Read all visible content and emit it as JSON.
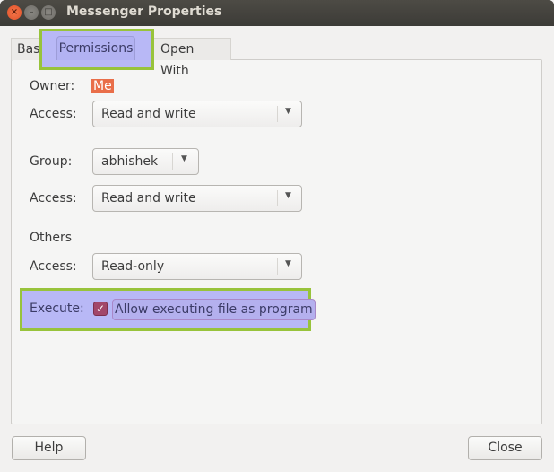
{
  "window": {
    "title": "Messenger Properties",
    "controls": {
      "close": "×",
      "minimize": "–",
      "maximize": "□"
    }
  },
  "tabs": [
    {
      "label": "Basic",
      "active": false
    },
    {
      "label": "Permissions",
      "active": true
    },
    {
      "label": "Open With",
      "active": false
    }
  ],
  "permissions": {
    "owner_label": "Owner:",
    "owner_value": "Me",
    "owner_access_label": "Access:",
    "owner_access_value": "Read and write",
    "group_label": "Group:",
    "group_value": "abhishek",
    "group_access_label": "Access:",
    "group_access_value": "Read and write",
    "others_label": "Others",
    "others_access_label": "Access:",
    "others_access_value": "Read-only",
    "execute_label": "Execute:",
    "execute_checkbox_label": "Allow executing file as program",
    "execute_checked": true
  },
  "icons": {
    "dropdown": "▼",
    "check": "✓"
  },
  "footer": {
    "help_label": "Help",
    "close_label": "Close"
  },
  "colors": {
    "highlight_fill": "#b8b8f6",
    "highlight_border": "#98c33b",
    "accent": "#e96e49",
    "checkbox": "#a2476a"
  }
}
